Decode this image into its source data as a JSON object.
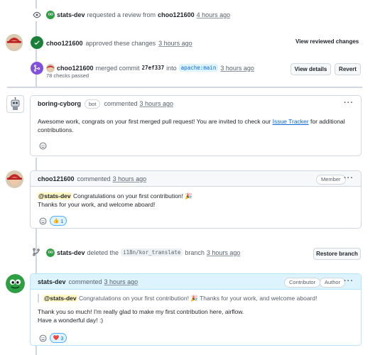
{
  "events": {
    "review_request": {
      "user": "stats-dev",
      "text": "requested a review from",
      "target": "choo121600",
      "time": "4 hours ago"
    },
    "approval": {
      "user": "choo121600",
      "text": "approved these changes",
      "time": "3 hours ago",
      "button": "View reviewed changes"
    },
    "merge": {
      "user": "choo121600",
      "text_merged": "merged commit",
      "commit": "27ef337",
      "text_into": "into",
      "branch": "apache:main",
      "time": "3 hours ago",
      "checks": "78 checks passed",
      "view_details": "View details",
      "revert": "Revert"
    },
    "branch_delete": {
      "user": "stats-dev",
      "text_deleted": "deleted the",
      "branch": "i18n/kor_translate",
      "text_branch": "branch",
      "time": "3 hours ago",
      "restore": "Restore branch"
    }
  },
  "comments": [
    {
      "user": "boring-cyborg",
      "bot_label": "bot",
      "action": "commented",
      "time": "3 hours ago",
      "body_pre": "Awesome work, congrats on your first merged pull request! You are invited to check our",
      "body_link": "Issue Tracker",
      "body_post": "for additional contributions.",
      "menu": "···"
    },
    {
      "user": "choo121600",
      "action": "commented",
      "time": "3 hours ago",
      "role": "Member",
      "mention": "@stats-dev",
      "line1": "Congratulations on your first contribution! 🎉",
      "line2": "Thanks for your work, and welcome aboard!",
      "reaction_emoji": "👍",
      "reaction_count": "1",
      "menu": "···"
    },
    {
      "user": "stats-dev",
      "action": "commented",
      "time": "3 hours ago",
      "role1": "Contributor",
      "role2": "Author",
      "quote_mention": "@stats-dev",
      "quote_text": "Congratulations on your first contribution! 🎉 Thanks for your work, and welcome aboard!",
      "line1": "Thank you so much! I'm really glad to make my first contribution here, airflow.",
      "line2": "Have a wonderful day! :)",
      "reaction_emoji": "❤️",
      "reaction_count": "3",
      "menu": "···"
    }
  ],
  "colors": {
    "approved": "#1a7f37",
    "merged": "#8250df",
    "link": "#0969da",
    "author_header": "#ddf4ff"
  }
}
